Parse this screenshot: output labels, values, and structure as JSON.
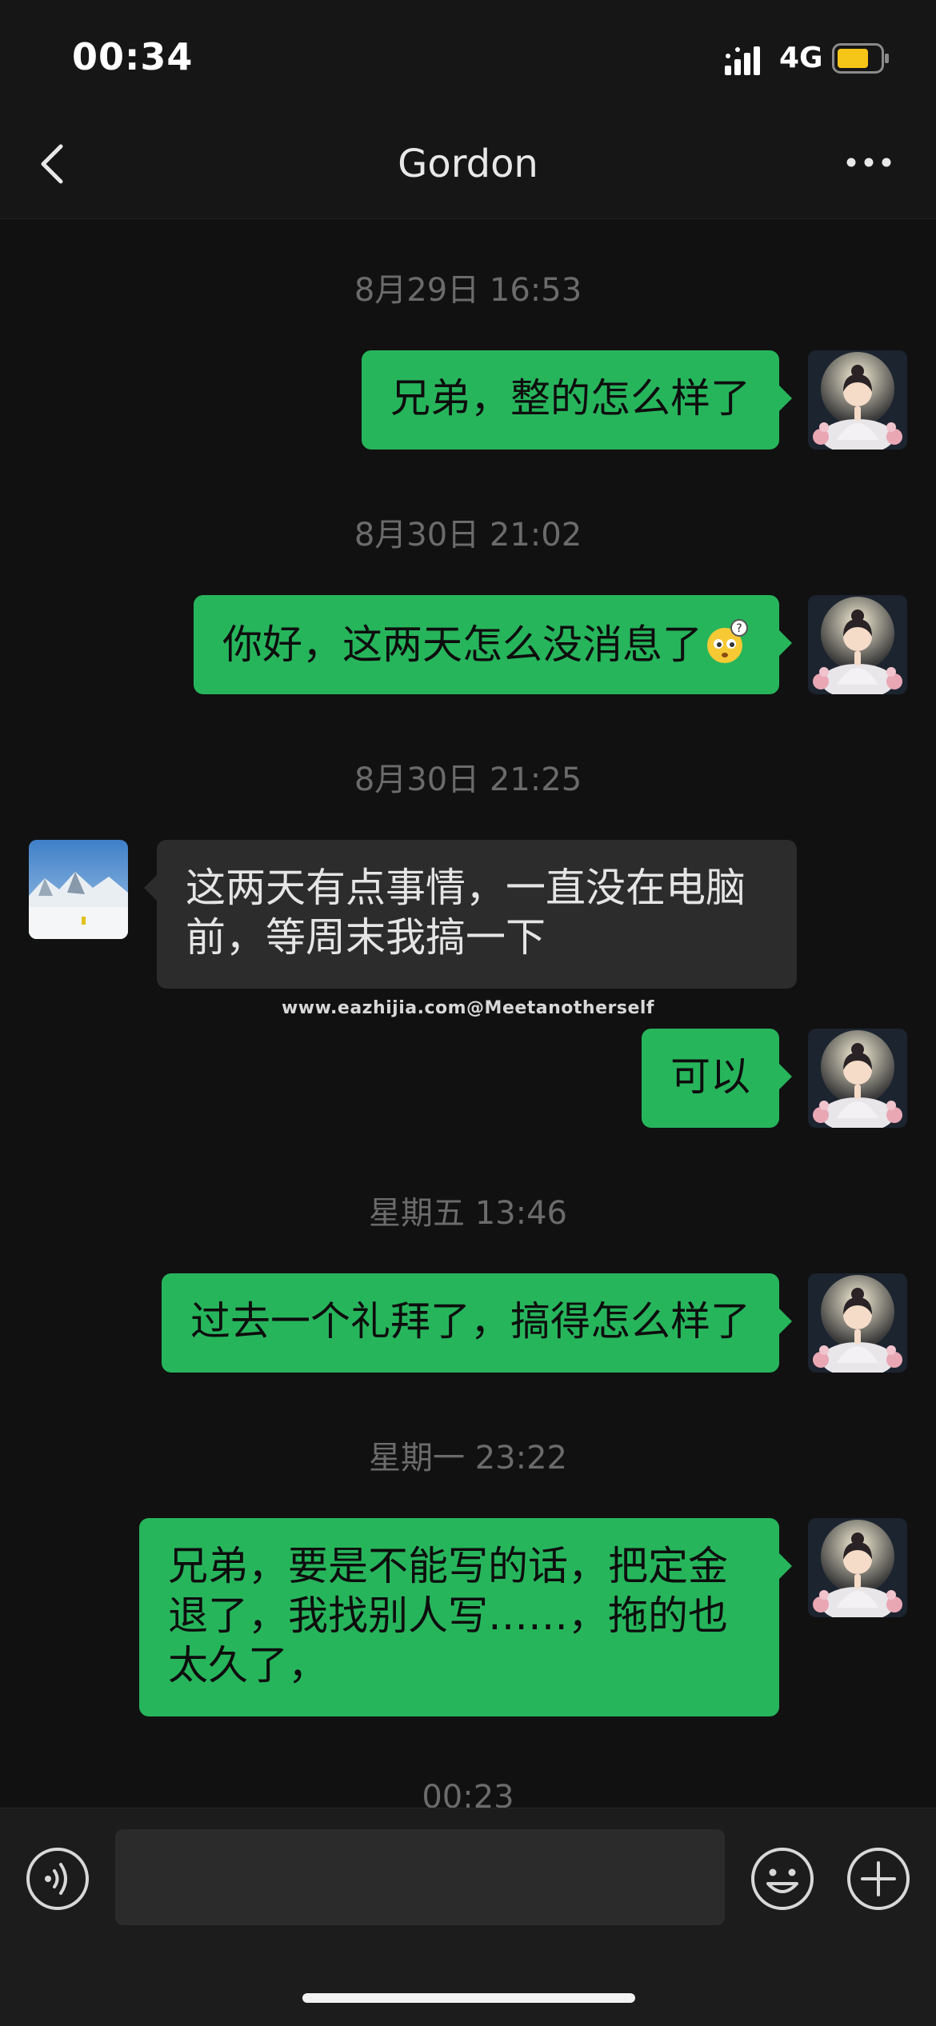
{
  "status_bar": {
    "time": "00:34",
    "network": "4G",
    "battery_color": "#f5c518"
  },
  "nav": {
    "title": "Gordon",
    "back_icon": "chevron-left-icon",
    "more_icon": "more-dots-icon"
  },
  "messages": [
    {
      "timestamp": "8月29日 16:53"
    },
    {
      "direction": "out",
      "text": "兄弟，整的怎么样了"
    },
    {
      "timestamp": "8月30日 21:02"
    },
    {
      "direction": "out",
      "text": "你好，这两天怎么没消息了",
      "emoji": "thinking-face-emoji"
    },
    {
      "timestamp": "8月30日 21:25"
    },
    {
      "direction": "in",
      "text": "这两天有点事情，一直没在电脑前，等周末我搞一下"
    },
    {
      "direction": "out",
      "text": "可以"
    },
    {
      "timestamp": "星期五 13:46"
    },
    {
      "direction": "out",
      "text": "过去一个礼拜了，搞得怎么样了"
    },
    {
      "timestamp": "星期一 23:22"
    },
    {
      "direction": "out",
      "text": "兄弟，要是不能写的话，把定金退了，我找别人写……，拖的也太久了，"
    },
    {
      "timestamp": "00:23"
    }
  ],
  "watermark": "www.eazhijia.com@Meetanotherself",
  "input_bar": {
    "placeholder": "",
    "voice_icon": "voice-icon",
    "emoji_icon": "smiley-icon",
    "plus_icon": "plus-icon"
  },
  "colors": {
    "bubble_out": "#27b55c",
    "bubble_in": "#2c2c2c",
    "background": "#111111"
  }
}
